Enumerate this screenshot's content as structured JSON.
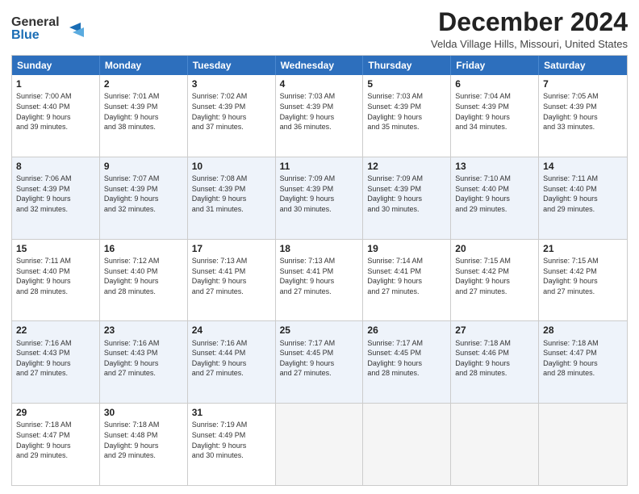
{
  "logo": {
    "line1": "General",
    "line2": "Blue"
  },
  "title": "December 2024",
  "subtitle": "Velda Village Hills, Missouri, United States",
  "days": [
    "Sunday",
    "Monday",
    "Tuesday",
    "Wednesday",
    "Thursday",
    "Friday",
    "Saturday"
  ],
  "rows": [
    [
      {
        "num": "1",
        "lines": [
          "Sunrise: 7:00 AM",
          "Sunset: 4:40 PM",
          "Daylight: 9 hours",
          "and 39 minutes."
        ]
      },
      {
        "num": "2",
        "lines": [
          "Sunrise: 7:01 AM",
          "Sunset: 4:39 PM",
          "Daylight: 9 hours",
          "and 38 minutes."
        ]
      },
      {
        "num": "3",
        "lines": [
          "Sunrise: 7:02 AM",
          "Sunset: 4:39 PM",
          "Daylight: 9 hours",
          "and 37 minutes."
        ]
      },
      {
        "num": "4",
        "lines": [
          "Sunrise: 7:03 AM",
          "Sunset: 4:39 PM",
          "Daylight: 9 hours",
          "and 36 minutes."
        ]
      },
      {
        "num": "5",
        "lines": [
          "Sunrise: 7:03 AM",
          "Sunset: 4:39 PM",
          "Daylight: 9 hours",
          "and 35 minutes."
        ]
      },
      {
        "num": "6",
        "lines": [
          "Sunrise: 7:04 AM",
          "Sunset: 4:39 PM",
          "Daylight: 9 hours",
          "and 34 minutes."
        ]
      },
      {
        "num": "7",
        "lines": [
          "Sunrise: 7:05 AM",
          "Sunset: 4:39 PM",
          "Daylight: 9 hours",
          "and 33 minutes."
        ]
      }
    ],
    [
      {
        "num": "8",
        "lines": [
          "Sunrise: 7:06 AM",
          "Sunset: 4:39 PM",
          "Daylight: 9 hours",
          "and 32 minutes."
        ]
      },
      {
        "num": "9",
        "lines": [
          "Sunrise: 7:07 AM",
          "Sunset: 4:39 PM",
          "Daylight: 9 hours",
          "and 32 minutes."
        ]
      },
      {
        "num": "10",
        "lines": [
          "Sunrise: 7:08 AM",
          "Sunset: 4:39 PM",
          "Daylight: 9 hours",
          "and 31 minutes."
        ]
      },
      {
        "num": "11",
        "lines": [
          "Sunrise: 7:09 AM",
          "Sunset: 4:39 PM",
          "Daylight: 9 hours",
          "and 30 minutes."
        ]
      },
      {
        "num": "12",
        "lines": [
          "Sunrise: 7:09 AM",
          "Sunset: 4:39 PM",
          "Daylight: 9 hours",
          "and 30 minutes."
        ]
      },
      {
        "num": "13",
        "lines": [
          "Sunrise: 7:10 AM",
          "Sunset: 4:40 PM",
          "Daylight: 9 hours",
          "and 29 minutes."
        ]
      },
      {
        "num": "14",
        "lines": [
          "Sunrise: 7:11 AM",
          "Sunset: 4:40 PM",
          "Daylight: 9 hours",
          "and 29 minutes."
        ]
      }
    ],
    [
      {
        "num": "15",
        "lines": [
          "Sunrise: 7:11 AM",
          "Sunset: 4:40 PM",
          "Daylight: 9 hours",
          "and 28 minutes."
        ]
      },
      {
        "num": "16",
        "lines": [
          "Sunrise: 7:12 AM",
          "Sunset: 4:40 PM",
          "Daylight: 9 hours",
          "and 28 minutes."
        ]
      },
      {
        "num": "17",
        "lines": [
          "Sunrise: 7:13 AM",
          "Sunset: 4:41 PM",
          "Daylight: 9 hours",
          "and 27 minutes."
        ]
      },
      {
        "num": "18",
        "lines": [
          "Sunrise: 7:13 AM",
          "Sunset: 4:41 PM",
          "Daylight: 9 hours",
          "and 27 minutes."
        ]
      },
      {
        "num": "19",
        "lines": [
          "Sunrise: 7:14 AM",
          "Sunset: 4:41 PM",
          "Daylight: 9 hours",
          "and 27 minutes."
        ]
      },
      {
        "num": "20",
        "lines": [
          "Sunrise: 7:15 AM",
          "Sunset: 4:42 PM",
          "Daylight: 9 hours",
          "and 27 minutes."
        ]
      },
      {
        "num": "21",
        "lines": [
          "Sunrise: 7:15 AM",
          "Sunset: 4:42 PM",
          "Daylight: 9 hours",
          "and 27 minutes."
        ]
      }
    ],
    [
      {
        "num": "22",
        "lines": [
          "Sunrise: 7:16 AM",
          "Sunset: 4:43 PM",
          "Daylight: 9 hours",
          "and 27 minutes."
        ]
      },
      {
        "num": "23",
        "lines": [
          "Sunrise: 7:16 AM",
          "Sunset: 4:43 PM",
          "Daylight: 9 hours",
          "and 27 minutes."
        ]
      },
      {
        "num": "24",
        "lines": [
          "Sunrise: 7:16 AM",
          "Sunset: 4:44 PM",
          "Daylight: 9 hours",
          "and 27 minutes."
        ]
      },
      {
        "num": "25",
        "lines": [
          "Sunrise: 7:17 AM",
          "Sunset: 4:45 PM",
          "Daylight: 9 hours",
          "and 27 minutes."
        ]
      },
      {
        "num": "26",
        "lines": [
          "Sunrise: 7:17 AM",
          "Sunset: 4:45 PM",
          "Daylight: 9 hours",
          "and 28 minutes."
        ]
      },
      {
        "num": "27",
        "lines": [
          "Sunrise: 7:18 AM",
          "Sunset: 4:46 PM",
          "Daylight: 9 hours",
          "and 28 minutes."
        ]
      },
      {
        "num": "28",
        "lines": [
          "Sunrise: 7:18 AM",
          "Sunset: 4:47 PM",
          "Daylight: 9 hours",
          "and 28 minutes."
        ]
      }
    ],
    [
      {
        "num": "29",
        "lines": [
          "Sunrise: 7:18 AM",
          "Sunset: 4:47 PM",
          "Daylight: 9 hours",
          "and 29 minutes."
        ]
      },
      {
        "num": "30",
        "lines": [
          "Sunrise: 7:18 AM",
          "Sunset: 4:48 PM",
          "Daylight: 9 hours",
          "and 29 minutes."
        ]
      },
      {
        "num": "31",
        "lines": [
          "Sunrise: 7:19 AM",
          "Sunset: 4:49 PM",
          "Daylight: 9 hours",
          "and 30 minutes."
        ]
      },
      null,
      null,
      null,
      null
    ]
  ]
}
